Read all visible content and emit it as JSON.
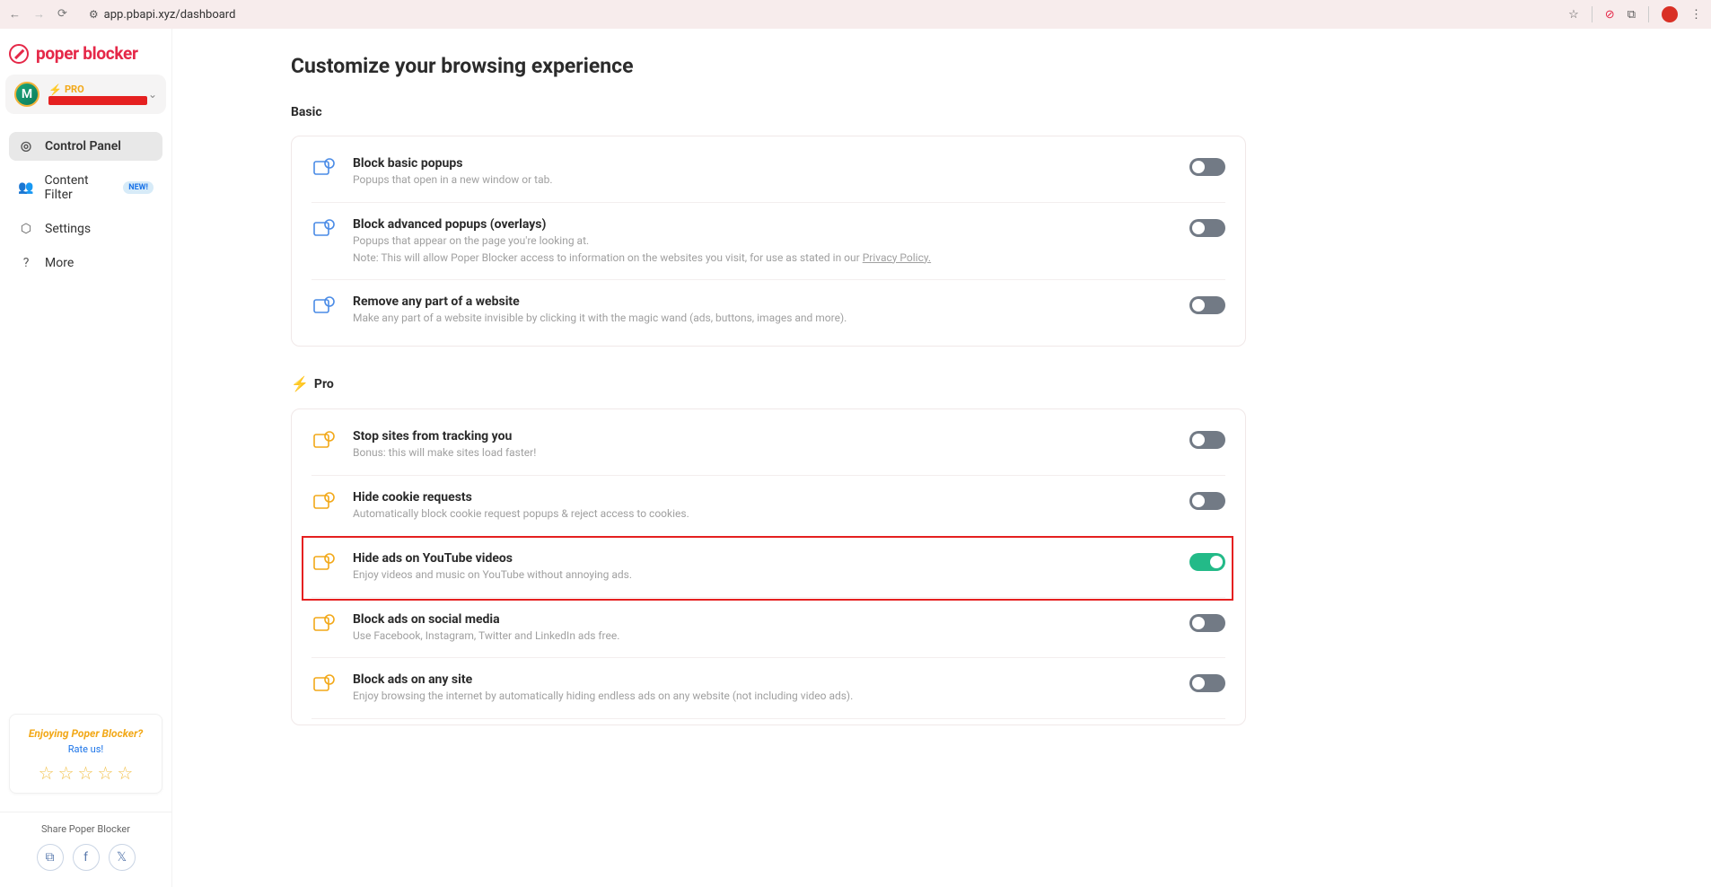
{
  "browser": {
    "url": "app.pbapi.xyz/dashboard"
  },
  "brand": {
    "name": "poper blocker"
  },
  "account": {
    "avatar_letter": "M",
    "plan_label": "PRO"
  },
  "sidebar": {
    "items": [
      {
        "label": "Control Panel",
        "active": true
      },
      {
        "label": "Content Filter",
        "badge": "NEW!"
      },
      {
        "label": "Settings"
      },
      {
        "label": "More"
      }
    ],
    "promo": {
      "title": "Enjoying Poper Blocker?",
      "link": "Rate us!"
    },
    "share_label": "Share Poper Blocker"
  },
  "page": {
    "title": "Customize your browsing experience",
    "section_basic": "Basic",
    "section_pro": "Pro",
    "privacy_link_text": "Privacy Policy."
  },
  "settings_basic": [
    {
      "title": "Block basic popups",
      "desc": "Popups that open in a new window or tab.",
      "enabled": true
    },
    {
      "title": "Block advanced popups (overlays)",
      "desc": "Popups that appear on the page you're looking at.",
      "desc2": "Note: This will allow Poper Blocker access to information on the websites you visit, for use as stated in our ",
      "enabled": true
    },
    {
      "title": "Remove any part of a website",
      "desc": "Make any part of a website invisible by clicking it with the magic wand (ads, buttons, images and more).",
      "enabled": true
    }
  ],
  "settings_pro": [
    {
      "title": "Stop sites from tracking you",
      "desc": "Bonus: this will make sites load faster!",
      "enabled": true
    },
    {
      "title": "Hide cookie requests",
      "desc": "Automatically block cookie request popups & reject access to cookies.",
      "enabled": true
    },
    {
      "title": "Hide ads on YouTube videos",
      "desc": "Enjoy videos and music on YouTube without annoying ads.",
      "enabled": true,
      "highlighted": true
    },
    {
      "title": "Block ads on social media",
      "desc": "Use Facebook, Instagram, Twitter and LinkedIn ads free.",
      "enabled": true
    },
    {
      "title": "Block ads on any site",
      "desc": "Enjoy browsing the internet by automatically hiding endless ads on any website (not including video ads).",
      "enabled": true
    }
  ]
}
